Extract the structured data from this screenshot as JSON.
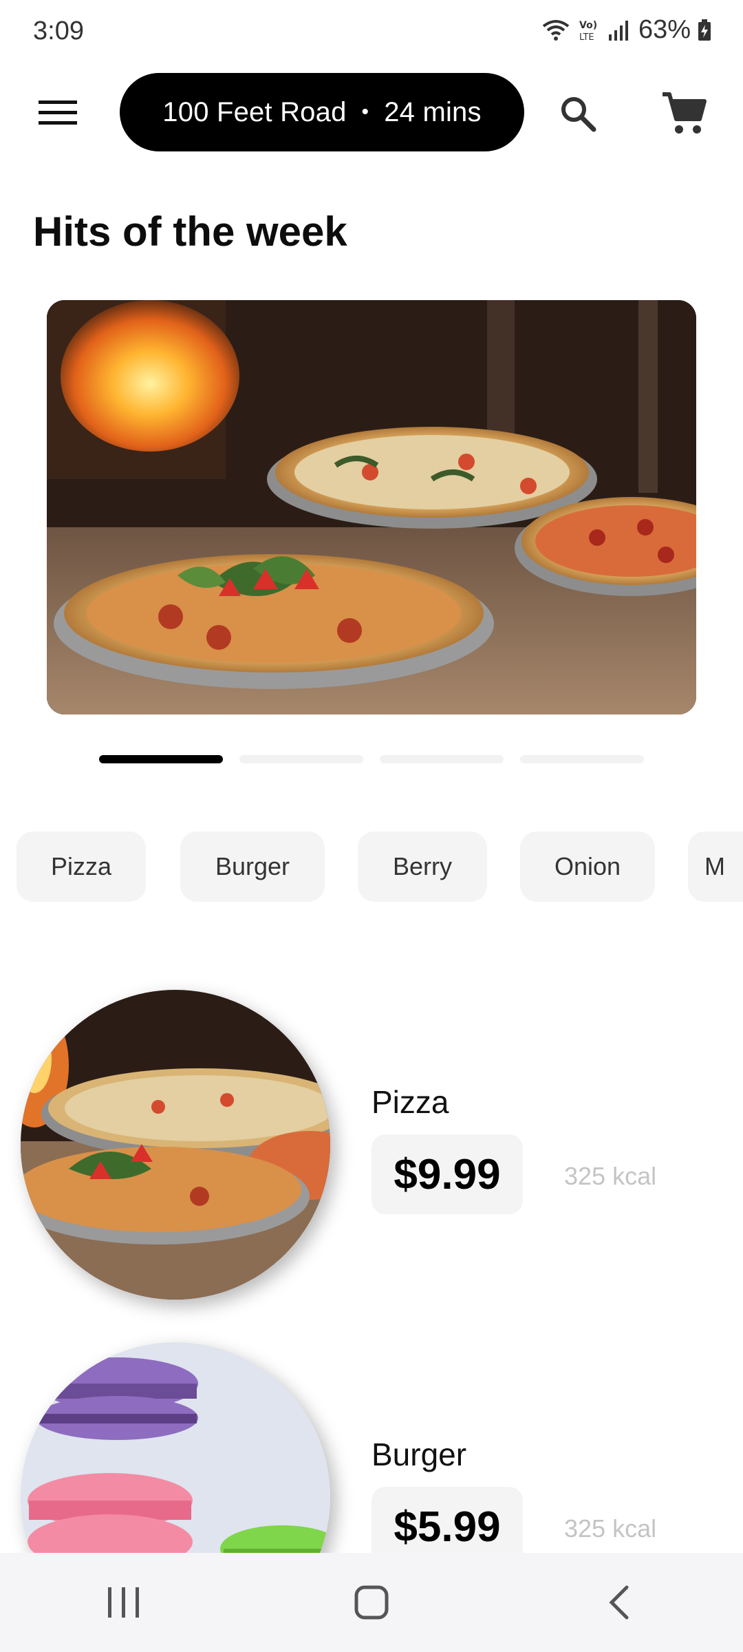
{
  "status_bar": {
    "time": "3:09",
    "battery": "63%"
  },
  "app_bar": {
    "location": "100 Feet Road",
    "separator": "•",
    "eta": "24 mins"
  },
  "section_title": "Hits of the week",
  "carousel": {
    "page_count": 4,
    "active_index": 0
  },
  "categories": [
    "Pizza",
    "Burger",
    "Berry",
    "Onion",
    "M"
  ],
  "products": [
    {
      "name": "Pizza",
      "price": "$9.99",
      "kcal": "325 kcal",
      "image": "pizza-photo"
    },
    {
      "name": "Burger",
      "price": "$5.99",
      "kcal": "325 kcal",
      "image": "macaron-photo"
    }
  ],
  "icons": {
    "menu": "hamburger-menu-icon",
    "search": "search-icon",
    "cart": "cart-icon"
  },
  "colors": {
    "accent": "#000000",
    "chip_bg": "#f4f4f4",
    "muted_text": "#c4c4c4"
  }
}
